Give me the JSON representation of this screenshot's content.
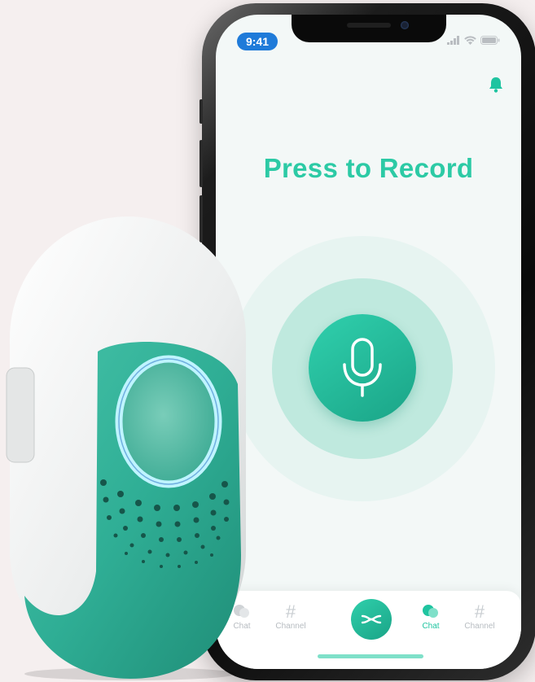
{
  "status_bar": {
    "time": "9:41"
  },
  "screen": {
    "title": "Press to Record",
    "record_button_icon": "microphone-icon",
    "notification_icon": "bell-icon"
  },
  "tab_bar": {
    "tabs": [
      {
        "label": "Chat",
        "icon": "chat-bubble-icon",
        "active": false
      },
      {
        "label": "Channel",
        "icon": "hash-icon",
        "active": false
      },
      {
        "label": "",
        "icon": "walkie-talkie-icon",
        "active": false
      },
      {
        "label": "Chat",
        "icon": "chat-bubble-icon",
        "active": true
      },
      {
        "label": "Channel",
        "icon": "hash-icon",
        "active": false
      }
    ]
  },
  "colors": {
    "accent": "#2ccaa5",
    "accent_dark": "#1aa487",
    "time_pill": "#1f7bd9",
    "device_teal": "#2fae95",
    "device_ring": "#9fe8ff"
  }
}
